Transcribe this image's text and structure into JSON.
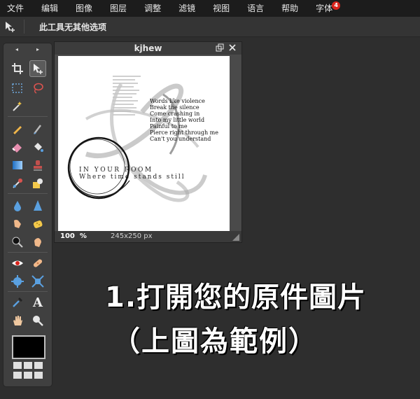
{
  "menubar": {
    "items": [
      "文件",
      "编辑",
      "图像",
      "图层",
      "调整",
      "滤镜",
      "视图",
      "语言",
      "帮助",
      "字体"
    ],
    "font_badge": "4"
  },
  "optionbar": {
    "hint": "此工具无其他选项"
  },
  "tools": {
    "nav_prev": "◂",
    "nav_next": "▸",
    "items": [
      "crop-icon",
      "move-icon",
      "marquee-icon",
      "lasso-icon",
      "magic-wand-icon",
      "pencil-icon",
      "brush-icon",
      "eraser-icon",
      "paint-bucket-icon",
      "gradient-icon",
      "clone-stamp-icon",
      "color-replace-icon",
      "drawing-icon",
      "blur-icon",
      "sharpen-icon",
      "smudge-icon",
      "sponge-icon",
      "dodge-icon",
      "burn-icon",
      "red-eye-icon",
      "spot-heal-icon",
      "bloat-icon",
      "pinch-icon",
      "color-picker-icon",
      "type-icon",
      "hand-icon",
      "zoom-icon"
    ],
    "primary_color": "#000000",
    "type_glyph": "A"
  },
  "document": {
    "title": "kjhew",
    "zoom": "100",
    "zoom_unit": "%",
    "size": "245x250 px",
    "poem": [
      "Words like violence",
      "Break the silence",
      "Come crashing in",
      "Into my little world",
      "Painful to me",
      "Pierce right through me",
      "Can't you understand"
    ],
    "room_line1": "IN YOUR ROOM",
    "room_line2": "Where time stands still"
  },
  "captions": {
    "line1": "1.打開您的原件圖片",
    "line2": "（上圖為範例）"
  }
}
